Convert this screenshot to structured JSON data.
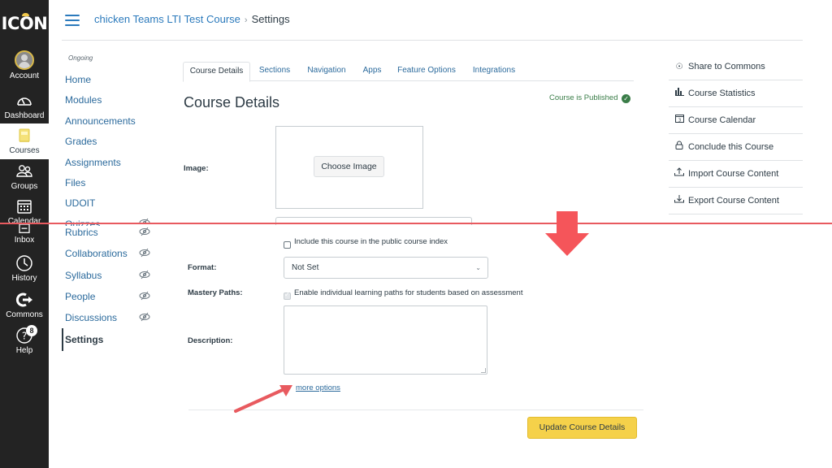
{
  "global_nav": {
    "logo": "ICON",
    "items": [
      {
        "label": "Account",
        "icon": "avatar-icon"
      },
      {
        "label": "Dashboard",
        "icon": "dashboard-gauge-icon"
      },
      {
        "label": "Courses",
        "icon": "courses-book-icon",
        "active": true
      },
      {
        "label": "Groups",
        "icon": "groups-icon"
      },
      {
        "label": "Calendar",
        "icon": "calendar-icon"
      },
      {
        "label": "Inbox",
        "icon": "inbox-icon"
      },
      {
        "label": "History",
        "icon": "clock-icon"
      },
      {
        "label": "Commons",
        "icon": "commons-icon"
      },
      {
        "label": "Help",
        "icon": "help-icon",
        "badge": "8"
      }
    ]
  },
  "header": {
    "breadcrumb": [
      {
        "label": "chicken Teams LTI Test Course"
      },
      {
        "label": "Settings"
      }
    ],
    "separator": "›"
  },
  "course_nav": {
    "term": "Ongoing",
    "items": [
      {
        "label": "Home",
        "hidden": false
      },
      {
        "label": "Modules",
        "hidden": false
      },
      {
        "label": "Announcements",
        "hidden": false
      },
      {
        "label": "Grades",
        "hidden": false
      },
      {
        "label": "Assignments",
        "hidden": false
      },
      {
        "label": "Files",
        "hidden": false
      },
      {
        "label": "UDOIT",
        "hidden": false
      },
      {
        "label": "Quizzes",
        "hidden": true
      },
      {
        "label": "Rubrics",
        "hidden": true
      },
      {
        "label": "Collaborations",
        "hidden": true
      },
      {
        "label": "Syllabus",
        "hidden": true
      },
      {
        "label": "People",
        "hidden": true
      },
      {
        "label": "Discussions",
        "hidden": true
      },
      {
        "label": "Settings",
        "hidden": false,
        "active": true
      }
    ],
    "hidden_icon": "eye-slash-icon"
  },
  "tabs": [
    {
      "label": "Course Details",
      "active": true
    },
    {
      "label": "Sections"
    },
    {
      "label": "Navigation"
    },
    {
      "label": "Apps"
    },
    {
      "label": "Feature Options"
    },
    {
      "label": "Integrations"
    }
  ],
  "main": {
    "title": "Course Details",
    "status": "Course is Published",
    "status_color": "#3a7d48",
    "image_label": "Image:",
    "choose_image": "Choose Image",
    "public_index_label": "Include this course in the public course index",
    "public_index_checked": false,
    "format_label": "Format:",
    "format_value": "Not Set",
    "mastery_label": "Mastery Paths:",
    "mastery_text": "Enable individual learning paths for students based on assessment",
    "mastery_checked": true,
    "mastery_disabled": true,
    "description_label": "Description:",
    "description_value": "",
    "more_options": "more options",
    "update_button": "Update Course Details",
    "update_button_color": "#f5d14a"
  },
  "right_sidebar": {
    "items": [
      {
        "label": "Share to Commons",
        "icon": "commons-share-icon"
      },
      {
        "label": "Course Statistics",
        "icon": "bar-chart-icon"
      },
      {
        "label": "Course Calendar",
        "icon": "calendar-icon"
      },
      {
        "label": "Conclude this Course",
        "icon": "lock-icon"
      },
      {
        "label": "Import Course Content",
        "icon": "upload-icon"
      },
      {
        "label": "Export Course Content",
        "icon": "download-icon"
      }
    ]
  },
  "annotations": {
    "color": "#e85a5f"
  }
}
